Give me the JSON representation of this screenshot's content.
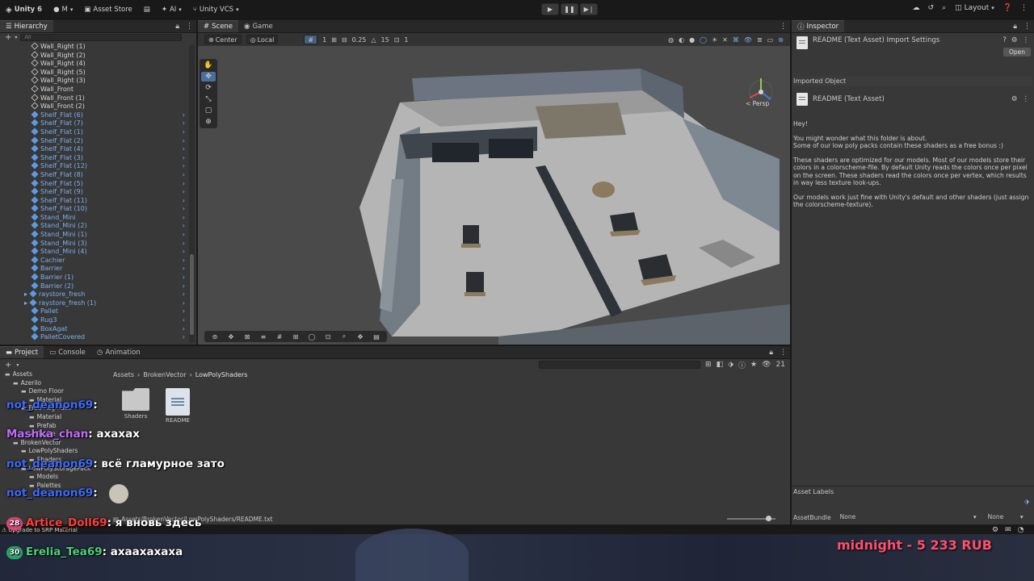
{
  "toolbar": {
    "app_title": "Unity 6",
    "account": "M",
    "asset_store": "Asset Store",
    "ai": "AI",
    "vcs": "Unity VCS",
    "layout": "Layout"
  },
  "hierarchy": {
    "tab": "Hierarchy",
    "search_placeholder": "All",
    "items": [
      {
        "label": "Wall_Right (1)",
        "color": "white"
      },
      {
        "label": "Wall_Right (2)",
        "color": "white"
      },
      {
        "label": "Wall_Right (4)",
        "color": "white"
      },
      {
        "label": "Wall_Right (5)",
        "color": "white"
      },
      {
        "label": "Wall_Right (3)",
        "color": "white"
      },
      {
        "label": "Wall_Front",
        "color": "white"
      },
      {
        "label": "Wall_Front (1)",
        "color": "white"
      },
      {
        "label": "Wall_Front (2)",
        "color": "white"
      },
      {
        "label": "Shelf_Flat (6)",
        "color": "blue"
      },
      {
        "label": "Shelf_Flat (7)",
        "color": "blue"
      },
      {
        "label": "Shelf_Flat (1)",
        "color": "blue"
      },
      {
        "label": "Shelf_Flat (2)",
        "color": "blue"
      },
      {
        "label": "Shelf_Flat (4)",
        "color": "blue"
      },
      {
        "label": "Shelf_Flat (3)",
        "color": "blue"
      },
      {
        "label": "Shelf_Flat (12)",
        "color": "blue"
      },
      {
        "label": "Shelf_Flat (8)",
        "color": "blue"
      },
      {
        "label": "Shelf_Flat (5)",
        "color": "blue"
      },
      {
        "label": "Shelf_Flat (9)",
        "color": "blue"
      },
      {
        "label": "Shelf_Flat (11)",
        "color": "blue"
      },
      {
        "label": "Shelf_Flat (10)",
        "color": "blue"
      },
      {
        "label": "Stand_Mini",
        "color": "blue"
      },
      {
        "label": "Stand_Mini (2)",
        "color": "blue"
      },
      {
        "label": "Stand_Mini (1)",
        "color": "blue"
      },
      {
        "label": "Stand_Mini (3)",
        "color": "blue"
      },
      {
        "label": "Stand_Mini (4)",
        "color": "blue"
      },
      {
        "label": "Cachier",
        "color": "blue"
      },
      {
        "label": "Barrier",
        "color": "blue"
      },
      {
        "label": "Barrier (1)",
        "color": "blue"
      },
      {
        "label": "Barrier (2)",
        "color": "blue"
      },
      {
        "label": "raystore_fresh",
        "color": "blue"
      },
      {
        "label": "raystore_fresh (1)",
        "color": "blue"
      },
      {
        "label": "Pallet",
        "color": "blue"
      },
      {
        "label": "Rug3",
        "color": "blue"
      },
      {
        "label": "BoxAgat",
        "color": "blue"
      },
      {
        "label": "PalletCovered",
        "color": "blue"
      }
    ]
  },
  "scene": {
    "tab_scene": "Scene",
    "tab_game": "Game",
    "pivot": "Center",
    "space": "Local",
    "grid_value": "1",
    "snap_value": "0.25",
    "angle_value": "15",
    "scale_value": "1",
    "persp_label": "< Persp"
  },
  "inspector": {
    "tab": "Inspector",
    "header_title": "README (Text Asset) Import Settings",
    "open_button": "Open",
    "imported_object": "Imported Object",
    "object_title": "README (Text Asset)",
    "text": [
      "Hey!",
      "You might wonder what this folder is about.\nSome of our low poly packs contain these shaders as a free bonus :)",
      "These shaders are optimized for our models. Most of our models store their colors in a colorscheme-file. By default Unity reads the colors once per pixel on the screen. These shaders read the colors once per vertex, which results in way less texture look-ups.",
      "Our models work just fine with Unity's default and other shaders (just assign the colorscheme-texture)."
    ],
    "asset_labels": "Asset Labels",
    "asset_bundle": "AssetBundle",
    "bundle_value": "None",
    "variant_value": "None"
  },
  "project": {
    "tab_project": "Project",
    "tab_console": "Console",
    "tab_animation": "Animation",
    "breadcrumb": [
      "Assets",
      "BrokenVector",
      "LowPolyShaders"
    ],
    "item_count": "21",
    "tree": [
      {
        "label": "Assets",
        "indent": 0
      },
      {
        "label": "Azerilo",
        "indent": 1
      },
      {
        "label": "Demo Floor",
        "indent": 2
      },
      {
        "label": "Material",
        "indent": 3
      },
      {
        "label": "Free Rug Pack",
        "indent": 2
      },
      {
        "label": "Material",
        "indent": 3
      },
      {
        "label": "Prefab",
        "indent": 3
      },
      {
        "label": "Scene",
        "indent": 3
      },
      {
        "label": "BrokenVector",
        "indent": 1
      },
      {
        "label": "LowPolyShaders",
        "indent": 2
      },
      {
        "label": "Shaders",
        "indent": 3
      },
      {
        "label": "LowPolyStoragePack",
        "indent": 2
      },
      {
        "label": "Models",
        "indent": 3
      },
      {
        "label": "Palettes",
        "indent": 3
      }
    ],
    "files": [
      {
        "label": "Shaders",
        "kind": "folder"
      },
      {
        "label": "README",
        "kind": "doc"
      }
    ],
    "status_path": "Assets/BrokenVector/LowPolyShaders/README.txt",
    "upgrade_text": "Upgrade to SRP Material"
  },
  "chat": [
    {
      "user": "not_deanon69",
      "message": "",
      "badge": ""
    },
    {
      "user": "Mashka_chan",
      "message": "ахахах",
      "badge": ""
    },
    {
      "user": "not_deanon69",
      "message": "всё гламурное зато",
      "badge": ""
    },
    {
      "user": "not_deanon69",
      "message": "",
      "badge": ""
    },
    {
      "user": "Artice_Doll69",
      "message": "я вновь здесь",
      "badge": "28"
    },
    {
      "user": "Erelia_Tea69",
      "message": "ахаахахаха",
      "badge": "30"
    }
  ],
  "donation": "midnight - 5 233 RUB"
}
